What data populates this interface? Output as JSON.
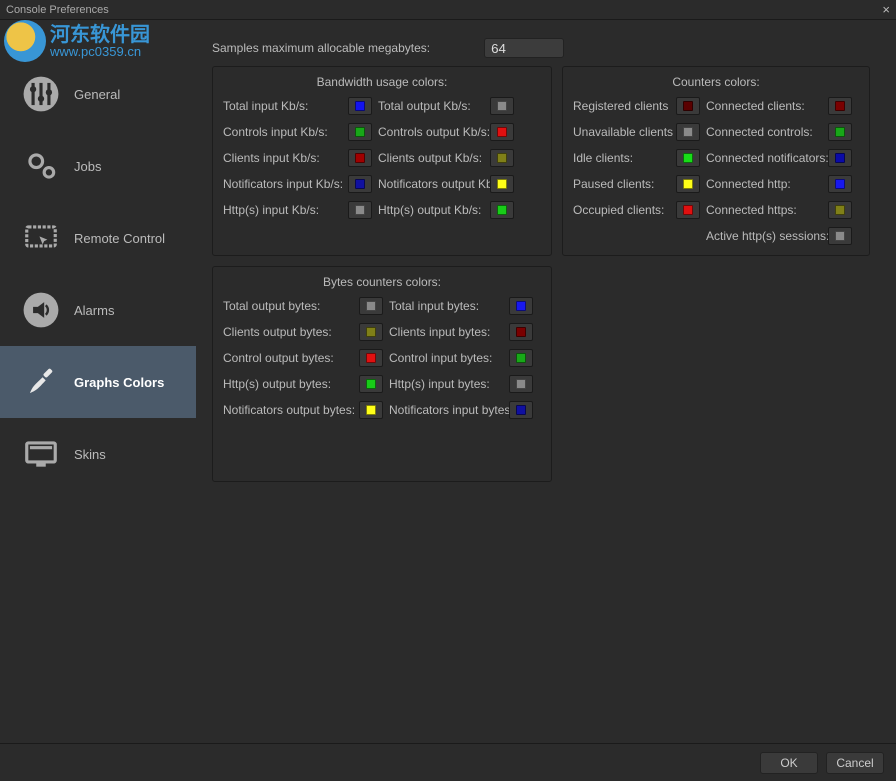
{
  "window": {
    "title": "Console Preferences",
    "close": "×"
  },
  "watermark": {
    "cn": "河东软件园",
    "url": "www.pc0359.cn"
  },
  "sidebar": {
    "items": [
      {
        "label": "General"
      },
      {
        "label": "Jobs"
      },
      {
        "label": "Remote Control"
      },
      {
        "label": "Alarms"
      },
      {
        "label": "Graphs Colors"
      },
      {
        "label": "Skins"
      }
    ]
  },
  "top": {
    "label": "Samples maximum allocable megabytes:",
    "value": "64"
  },
  "bandwidth": {
    "title": "Bandwidth usage colors:",
    "rows": [
      {
        "l1": "Total input Kb/s:",
        "c1": "#1313ee",
        "l2": "Total output Kb/s:",
        "c2": "#8a8a8a"
      },
      {
        "l1": "Controls input Kb/s:",
        "c1": "#18a818",
        "l2": "Controls output Kb/s:",
        "c2": "#e01010"
      },
      {
        "l1": "Clients input Kb/s:",
        "c1": "#a00000",
        "l2": "Clients output Kb/s:",
        "c2": "#808018"
      },
      {
        "l1": "Notificators input Kb/s:",
        "c1": "#1010a0",
        "l2": "Notificators output Kb/s:",
        "c2": "#ffff18"
      },
      {
        "l1": "Http(s) input Kb/s:",
        "c1": "#8a8a8a",
        "l2": "Http(s) output Kb/s:",
        "c2": "#18cc18"
      }
    ]
  },
  "counters": {
    "title": "Counters colors:",
    "rows": [
      {
        "l1": "Registered clients",
        "c1": "#5a0000",
        "l2": "Connected clients:",
        "c2": "#7a0000"
      },
      {
        "l1": "Unavailable clients",
        "c1": "#8a8a8a",
        "l2": "Connected controls:",
        "c2": "#18a818"
      },
      {
        "l1": "Idle clients:",
        "c1": "#18dd18",
        "l2": "Connected notificators:",
        "c2": "#0a0aa8"
      },
      {
        "l1": "Paused clients:",
        "c1": "#ffff18",
        "l2": "Connected http:",
        "c2": "#1818ee"
      },
      {
        "l1": "Occupied clients:",
        "c1": "#e01010",
        "l2": "Connected https:",
        "c2": "#808018"
      },
      {
        "l1": "",
        "c1": "",
        "l2": "Active http(s) sessions:",
        "c2": "#8a8a8a"
      }
    ]
  },
  "bytes": {
    "title": "Bytes counters colors:",
    "rows": [
      {
        "l1": "Total output bytes:",
        "c1": "#8a8a8a",
        "l2": "Total input bytes:",
        "c2": "#1818ee"
      },
      {
        "l1": "Clients output bytes:",
        "c1": "#808018",
        "l2": "Clients input bytes:",
        "c2": "#7a0000"
      },
      {
        "l1": "Control output bytes:",
        "c1": "#e01010",
        "l2": "Control input bytes:",
        "c2": "#18a818"
      },
      {
        "l1": "Http(s) output bytes:",
        "c1": "#18cc18",
        "l2": "Http(s) input bytes:",
        "c2": "#8a8a8a"
      },
      {
        "l1": "Notificators output bytes:",
        "c1": "#ffff18",
        "l2": "Notificators input bytes:",
        "c2": "#1010a0"
      }
    ]
  },
  "footer": {
    "ok": "OK",
    "cancel": "Cancel"
  }
}
